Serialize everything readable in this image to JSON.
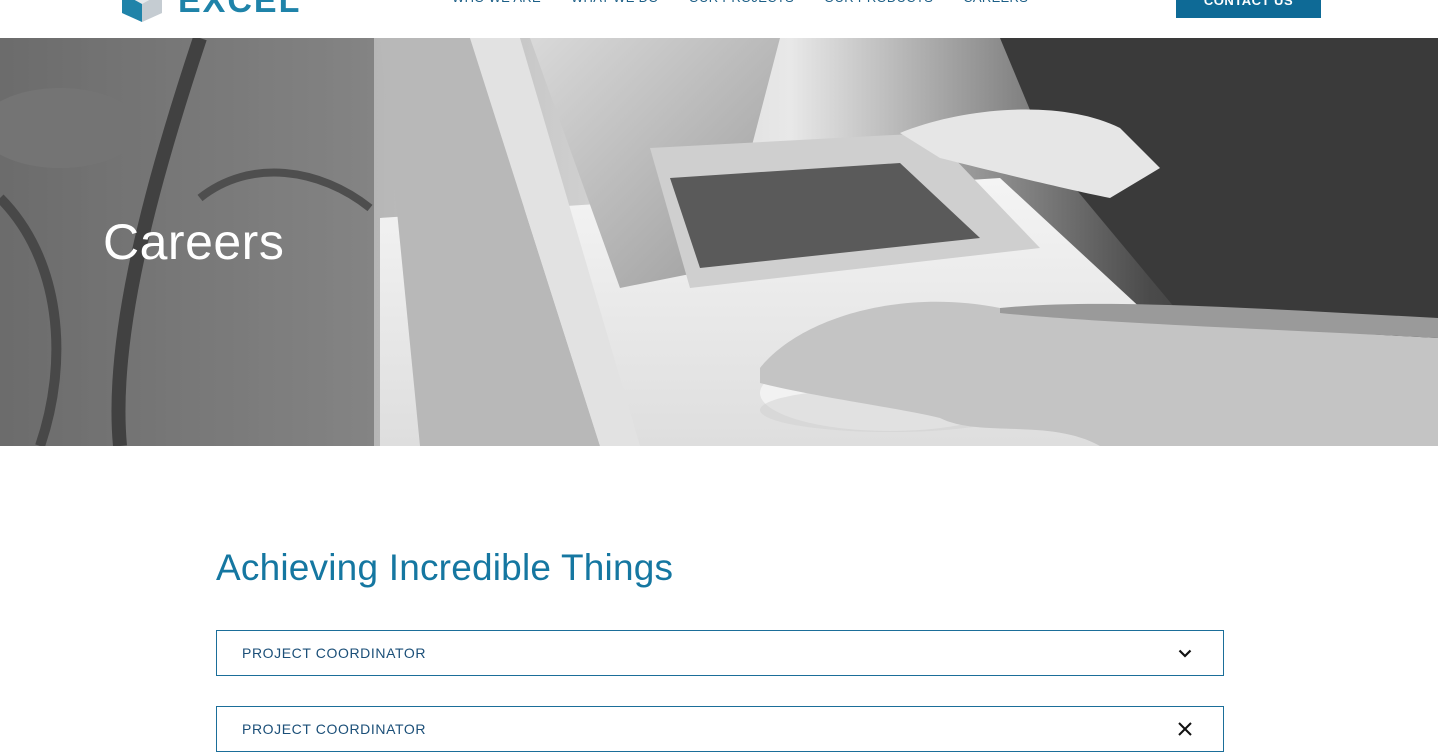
{
  "header": {
    "logo_text": "EXCEL",
    "nav": [
      "WHO WE ARE",
      "WHAT WE DO",
      "OUR PROJECTS",
      "OUR PRODUCTS",
      "CAREERS"
    ],
    "contact_label": "CONTACT US"
  },
  "hero": {
    "title": "Careers"
  },
  "content": {
    "heading": "Achieving Incredible Things",
    "accordion": [
      {
        "label": "PROJECT COORDINATOR",
        "icon": "chevron-down-icon",
        "state": "collapsed"
      },
      {
        "label": "PROJECT COORDINATOR",
        "icon": "close-icon",
        "state": "expanded"
      }
    ]
  },
  "colors": {
    "brand": "#1f83a9",
    "heading": "#1577a1",
    "button": "#0e6a96",
    "border": "#1b6e99"
  }
}
